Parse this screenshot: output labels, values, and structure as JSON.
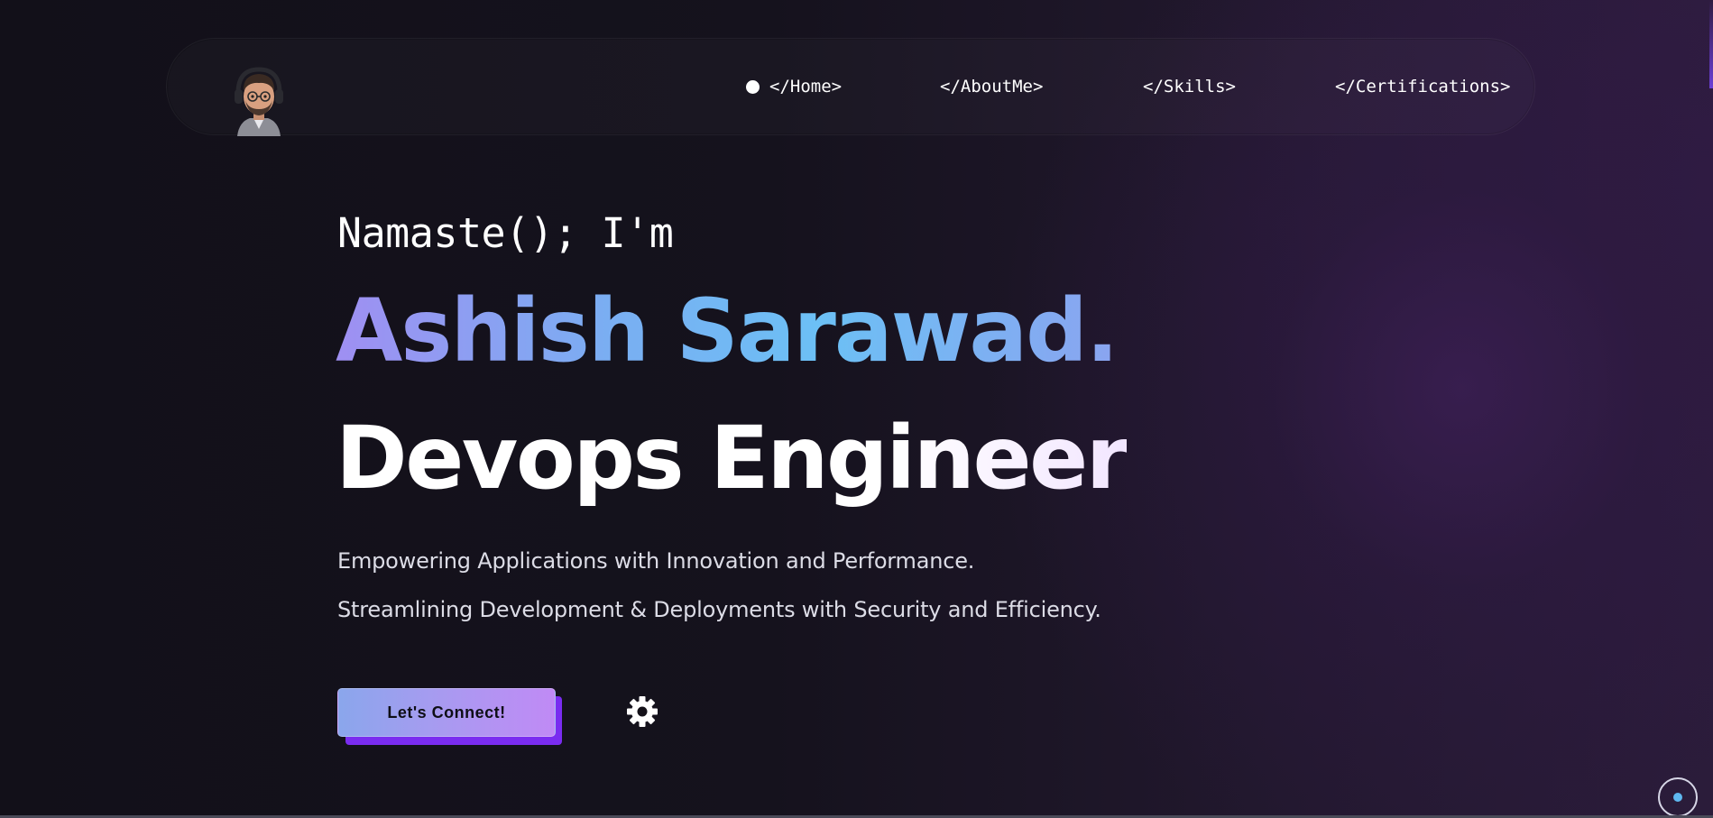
{
  "nav": {
    "avatar_alt": "avatar",
    "items": [
      {
        "label": "</Home>",
        "active": true
      },
      {
        "label": "</AboutMe>",
        "active": false
      },
      {
        "label": "</Skills>",
        "active": false
      },
      {
        "label": "</Certifications>",
        "active": false
      }
    ]
  },
  "hero": {
    "greeting": "Namaste(); I'm",
    "name": "Ashish Sarawad.",
    "role": "Devops Engineer",
    "tagline_1": "Empowering Applications with Innovation and Performance.",
    "tagline_2": "Streamlining Development & Deployments with Security and Efficiency.",
    "cta_label": "Let's Connect!"
  },
  "icons": {
    "settings": "gear-icon",
    "scroll": "scroll-indicator-icon",
    "active_nav": "dot-icon"
  },
  "colors": {
    "background": "#121019",
    "accent_purple": "#7a2cf0",
    "name_gradient_start": "#9f8ff2",
    "name_gradient_mid": "#6cc0f5",
    "scroll_dot": "#5fb8f0"
  }
}
